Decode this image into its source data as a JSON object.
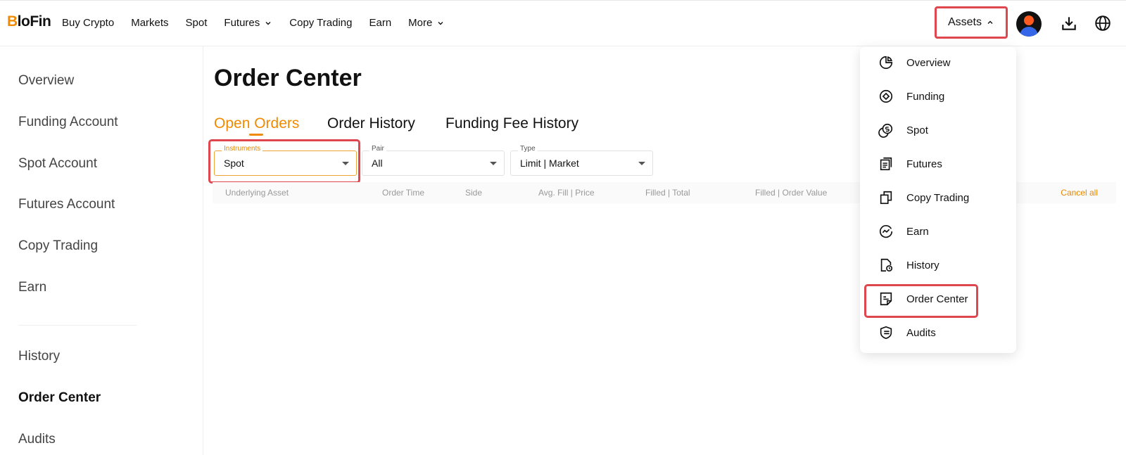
{
  "brand": {
    "logo_b": "B",
    "logo_rest": "loFin"
  },
  "nav": [
    {
      "label": "Buy Crypto"
    },
    {
      "label": "Markets"
    },
    {
      "label": "Spot"
    },
    {
      "label": "Futures"
    },
    {
      "label": "Copy Trading"
    },
    {
      "label": "Earn"
    },
    {
      "label": "More"
    }
  ],
  "header": {
    "assets_label": "Assets"
  },
  "sidebar": {
    "items": [
      {
        "label": "Overview"
      },
      {
        "label": "Funding Account"
      },
      {
        "label": "Spot Account"
      },
      {
        "label": "Futures Account"
      },
      {
        "label": "Copy Trading"
      },
      {
        "label": "Earn"
      },
      {
        "label": "History"
      },
      {
        "label": "Order Center"
      },
      {
        "label": "Audits"
      }
    ]
  },
  "main": {
    "title": "Order Center",
    "tabs": [
      {
        "label": "Open Orders"
      },
      {
        "label": "Order History"
      },
      {
        "label": "Funding Fee History"
      }
    ],
    "filters": {
      "instruments": {
        "legend": "Instruments",
        "value": "Spot"
      },
      "pair": {
        "legend": "Pair",
        "value": "All"
      },
      "type": {
        "legend": "Type",
        "value": "Limit | Market"
      }
    },
    "table": {
      "columns": [
        "Underlying Asset",
        "Order Time",
        "Side",
        "Avg. Fill | Price",
        "Filled | Total",
        "Filled | Order Value"
      ],
      "cancel_all": "Cancel all"
    }
  },
  "assets_menu": {
    "items": [
      {
        "label": "Overview",
        "icon": "pie-chart-icon"
      },
      {
        "label": "Funding",
        "icon": "funding-icon"
      },
      {
        "label": "Spot",
        "icon": "coins-icon"
      },
      {
        "label": "Futures",
        "icon": "futures-icon"
      },
      {
        "label": "Copy Trading",
        "icon": "copy-icon"
      },
      {
        "label": "Earn",
        "icon": "earn-icon"
      },
      {
        "label": "History",
        "icon": "history-icon"
      },
      {
        "label": "Order Center",
        "icon": "order-center-icon"
      },
      {
        "label": "Audits",
        "icon": "audits-icon"
      }
    ]
  },
  "colors": {
    "accent": "#f08a00",
    "highlight": "#e0464d",
    "text": "#111111",
    "muted": "#999999"
  }
}
